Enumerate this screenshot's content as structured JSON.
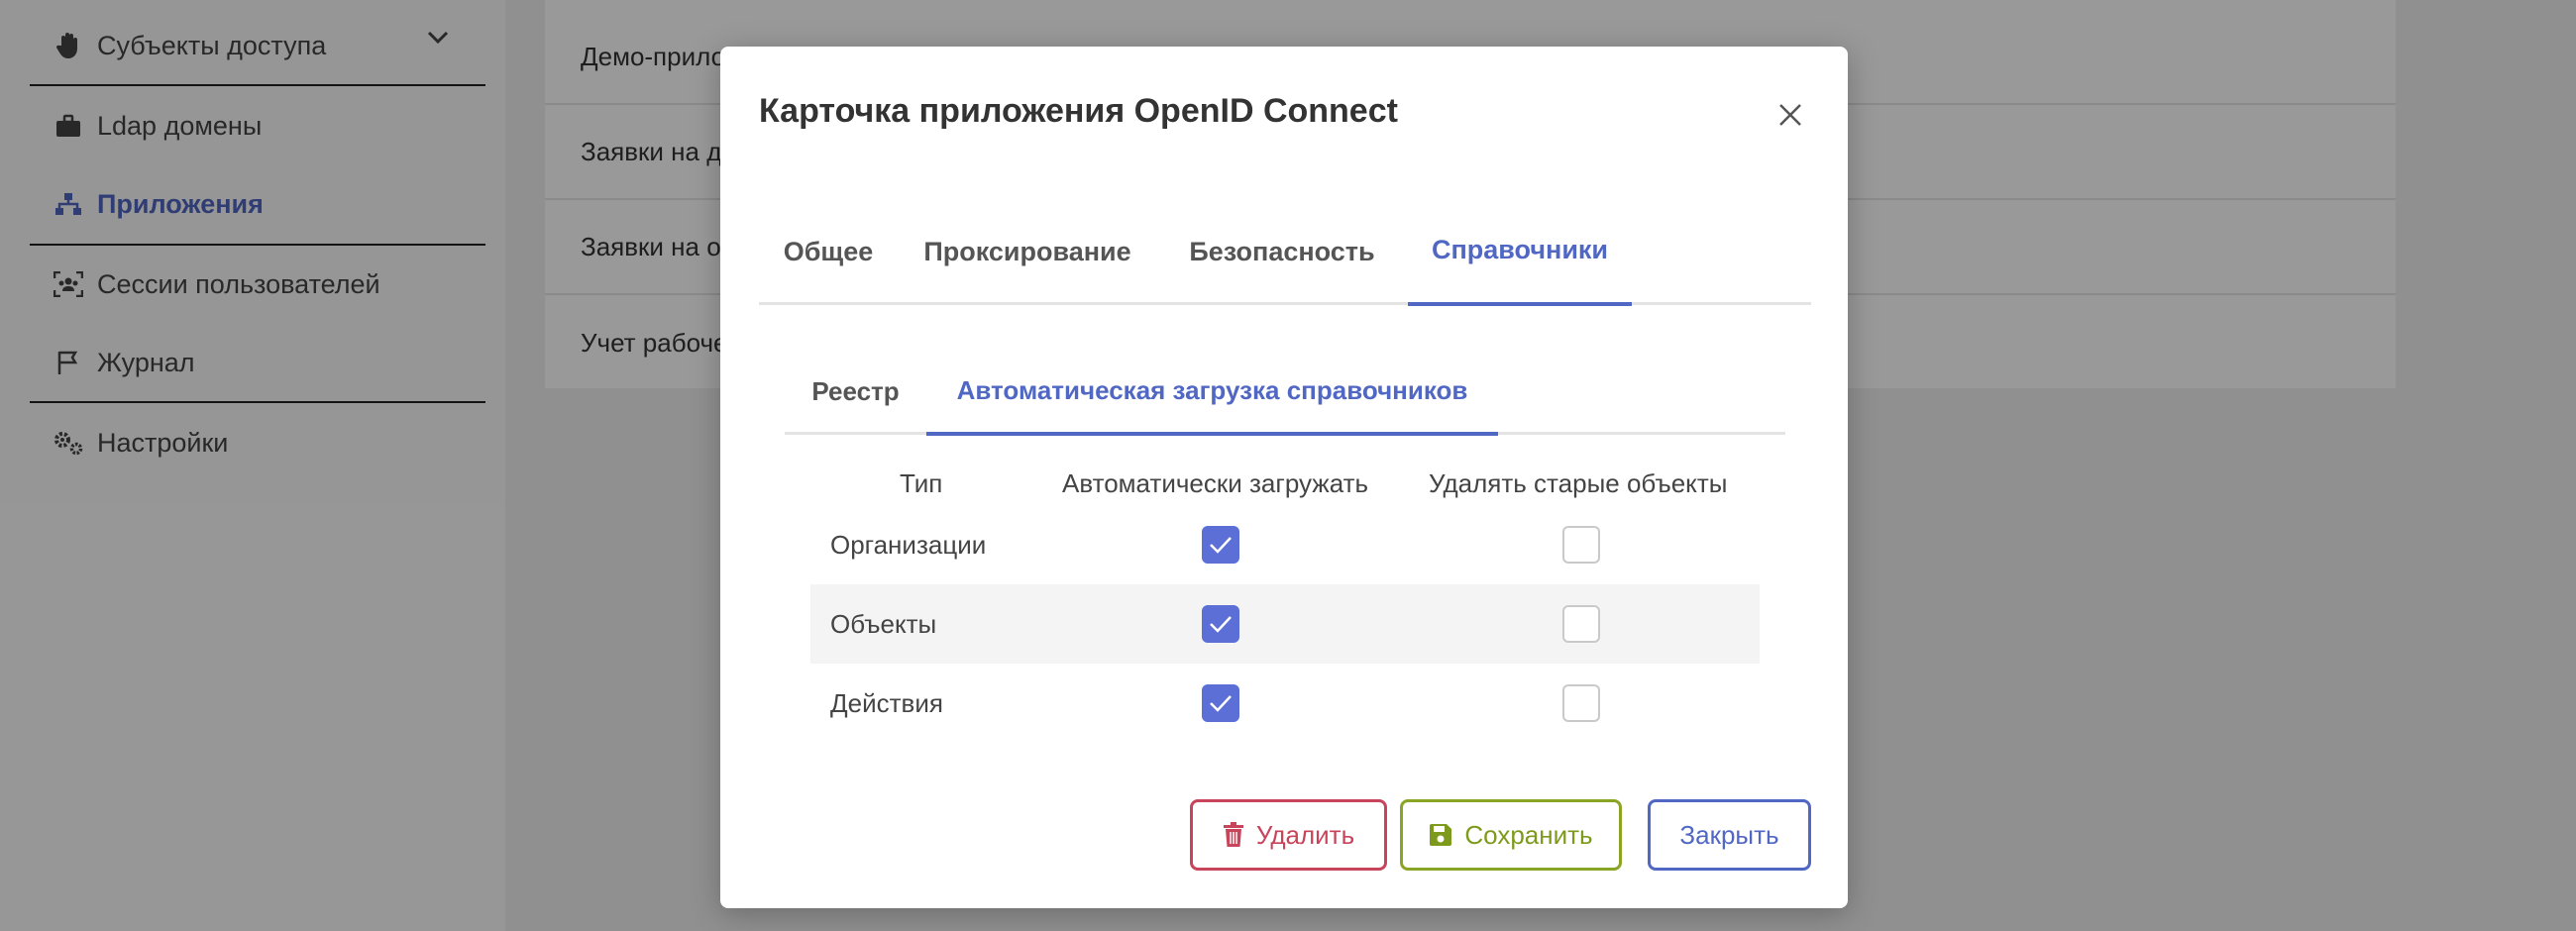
{
  "sidebar": {
    "items": [
      {
        "label": "Субъекты доступа",
        "icon": "hand-icon"
      },
      {
        "label": "Ldap домены",
        "icon": "briefcase-icon"
      },
      {
        "label": "Приложения",
        "icon": "sitemap-icon",
        "active": true
      },
      {
        "label": "Сессии пользователей",
        "icon": "users-scan-icon"
      },
      {
        "label": "Журнал",
        "icon": "flag-icon"
      },
      {
        "label": "Настройки",
        "icon": "gears-icon"
      }
    ]
  },
  "content": {
    "rows": [
      "Демо-прило",
      "Заявки на до",
      "Заявки на об",
      "Учет рабоче"
    ]
  },
  "modal": {
    "title": "Карточка приложения OpenID Connect",
    "tabs": [
      "Общее",
      "Проксирование",
      "Безопасность",
      "Справочники"
    ],
    "active_tab": "Справочники",
    "subtabs": [
      "Реестр",
      "Автоматическая загрузка справочников"
    ],
    "active_subtab": "Автоматическая загрузка справочников",
    "table": {
      "headers": [
        "Тип",
        "Автоматически загружать",
        "Удалять старые объекты"
      ],
      "rows": [
        {
          "type": "Организации",
          "auto_load": true,
          "delete_old": false
        },
        {
          "type": "Объекты",
          "auto_load": true,
          "delete_old": false
        },
        {
          "type": "Действия",
          "auto_load": true,
          "delete_old": false
        }
      ]
    },
    "buttons": {
      "delete": "Удалить",
      "save": "Сохранить",
      "close": "Закрыть"
    }
  },
  "colors": {
    "accent": "#5167c4",
    "checkbox_on": "#5b6fd6",
    "danger": "#c8445a",
    "success": "#8aa526"
  }
}
